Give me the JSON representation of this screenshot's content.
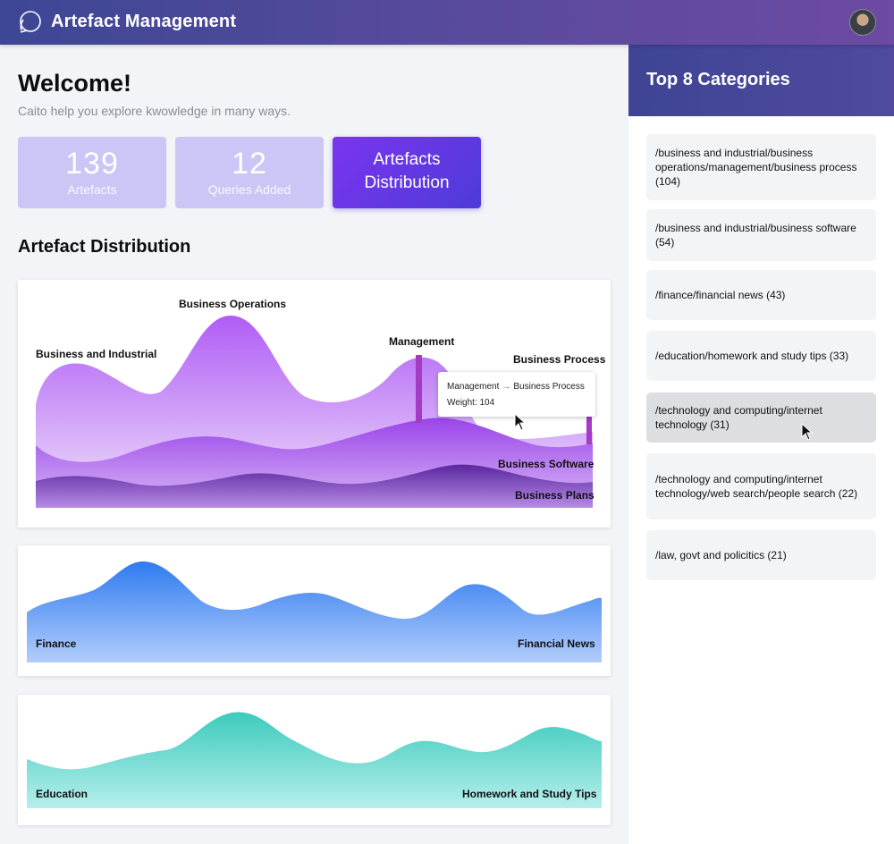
{
  "header": {
    "title": "Artefact Management",
    "logo_icon": "speech-bubble-icon",
    "avatar": "user-avatar"
  },
  "welcome": {
    "title": "Welcome!",
    "subtitle": "Caito help you explore kwowledge in many ways."
  },
  "stats": [
    {
      "value": "139",
      "label": "Artefacts"
    },
    {
      "value": "12",
      "label": "Queries Added"
    },
    {
      "label_line1": "Artefacts",
      "label_line2": "Distribution"
    }
  ],
  "section": {
    "title": "Artefact Distribution"
  },
  "charts": {
    "business": {
      "labels": {
        "business_and_industrial": "Business and Industrial",
        "business_operations": "Business Operations",
        "management": "Management",
        "business_process": "Business Process",
        "business_software": "Business Software",
        "business_plans": "Business Plans"
      },
      "tooltip": {
        "from": "Management",
        "to": "Business Process",
        "weight": "Weight: 104"
      },
      "colors": {
        "top": "#b361f5",
        "mid": "#9444e6",
        "bottom": "#5c2aa3"
      }
    },
    "finance": {
      "labels": {
        "left": "Finance",
        "right": "Financial News"
      },
      "colors": {
        "top": "#3a82f0",
        "bottom": "#a8c8fa"
      }
    },
    "education": {
      "labels": {
        "left": "Education",
        "right": "Homework and Study Tips"
      },
      "colors": {
        "top": "#3ccfc2",
        "bottom": "#b0ecea"
      }
    }
  },
  "sidebar": {
    "title": "Top 8 Categories",
    "categories": [
      "/business and industrial/business operations/management/business process (104)",
      "/business and industrial/business software (54)",
      "/finance/financial news (43)",
      "/education/homework and study tips (33)",
      "/technology and computing/internet technology (31)",
      "/technology and computing/internet technology/web search/people search (22)",
      "/law, govt and policitics (21)"
    ]
  }
}
